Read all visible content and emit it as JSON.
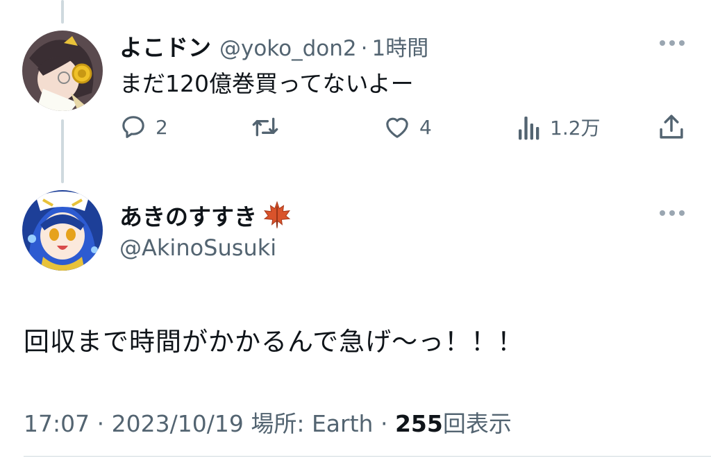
{
  "reply": {
    "display_name": "よこドン",
    "handle": "@yoko_don2",
    "separator": "·",
    "time": "1時間",
    "text": "まだ120億巻買ってないよー",
    "actions": {
      "reply_count": "2",
      "retweet_count": "",
      "like_count": "4",
      "views_count": "1.2万"
    }
  },
  "main_tweet": {
    "display_name": "あきのすすき",
    "emoji": "🍁",
    "handle": "@AkinoSusuki",
    "text": "回収まで時間がかかるんで急げ〜っ！！！",
    "footer": {
      "time": "17:07",
      "dot1": "·",
      "date": "2023/10/19",
      "location_label": "場所:",
      "location": "Earth",
      "dot2": "·",
      "views_count": "255",
      "views_label": "回表示"
    }
  },
  "colors": {
    "text_primary": "#0f1419",
    "text_secondary": "#536471",
    "thread_line": "#cfd9de"
  }
}
